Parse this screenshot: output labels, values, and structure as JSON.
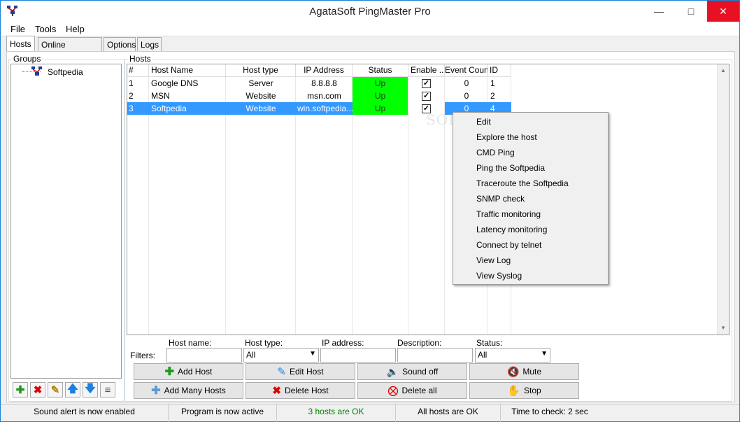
{
  "window": {
    "title": "AgataSoft PingMaster Pro"
  },
  "menu": [
    "File",
    "Tools",
    "Help"
  ],
  "tabs": [
    "Hosts",
    "Online monitoring",
    "Options",
    "Logs"
  ],
  "groups": {
    "legend": "Groups",
    "items": [
      "Softpedia"
    ]
  },
  "hosts": {
    "legend": "Hosts",
    "columns": [
      "#",
      "Host Name",
      "Host type",
      "IP Address",
      "Status",
      "Enable ...",
      "Event Count",
      "ID"
    ],
    "rows": [
      {
        "num": "1",
        "name": "Google DNS",
        "type": "Server",
        "ip": "8.8.8.8",
        "status": "Up",
        "enabled": true,
        "events": "0",
        "id": "1"
      },
      {
        "num": "2",
        "name": "MSN",
        "type": "Website",
        "ip": "msn.com",
        "status": "Up",
        "enabled": true,
        "events": "0",
        "id": "2"
      },
      {
        "num": "3",
        "name": "Softpedia",
        "type": "Website",
        "ip": "win.softpedia....",
        "status": "Up",
        "enabled": true,
        "events": "0",
        "id": "4"
      }
    ]
  },
  "context_menu": [
    "Edit",
    "Explore the host",
    "CMD Ping",
    "Ping the Softpedia",
    "Traceroute the Softpedia",
    "SNMP check",
    "Traffic monitoring",
    "Latency monitoring",
    "Connect by telnet",
    "View Log",
    "View Syslog"
  ],
  "filters": {
    "label": "Filters:",
    "host_name": {
      "label": "Host name:",
      "value": ""
    },
    "host_type": {
      "label": "Host type:",
      "value": "All"
    },
    "ip_address": {
      "label": "IP address:",
      "value": ""
    },
    "description": {
      "label": "Description:",
      "value": ""
    },
    "status": {
      "label": "Status:",
      "value": "All"
    }
  },
  "buttons": {
    "add_host": "Add Host",
    "edit_host": "Edit Host",
    "sound_off": "Sound off",
    "mute": "Mute",
    "add_many": "Add Many Hosts",
    "delete_host": "Delete Host",
    "delete_all": "Delete all",
    "stop": "Stop"
  },
  "statusbar": [
    "Sound alert is now enabled",
    "Program is now active",
    "3 hosts are OK",
    "All hosts are OK",
    "Time to check: 2 sec"
  ],
  "colors": {
    "selection": "#3399ff",
    "status_up": "#00ff00",
    "ok_text": "#008000"
  }
}
